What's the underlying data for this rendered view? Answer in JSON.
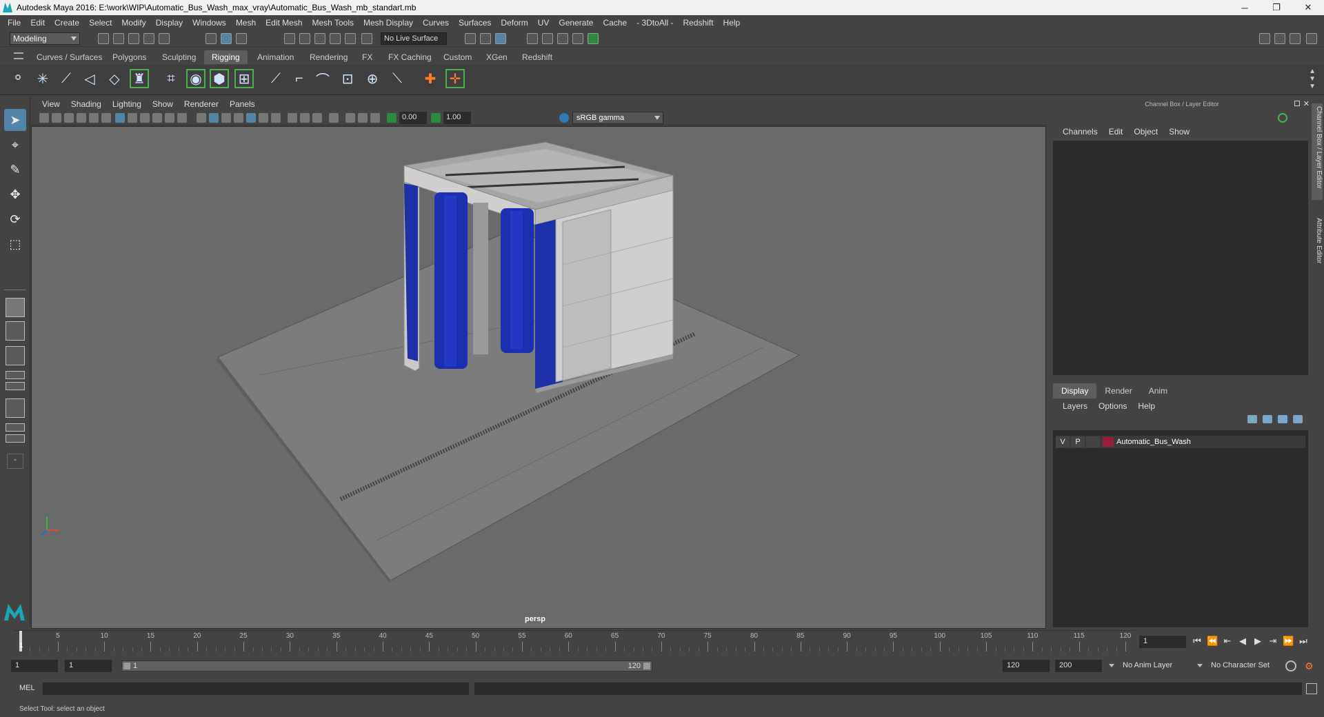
{
  "window": {
    "title": "Autodesk Maya 2016: E:\\work\\WIP\\Automatic_Bus_Wash_max_vray\\Automatic_Bus_Wash_mb_standart.mb",
    "minimize": "─",
    "restore": "❐",
    "close": "✕"
  },
  "menubar": [
    "File",
    "Edit",
    "Create",
    "Select",
    "Modify",
    "Display",
    "Windows",
    "Mesh",
    "Edit Mesh",
    "Mesh Tools",
    "Mesh Display",
    "Curves",
    "Surfaces",
    "Deform",
    "UV",
    "Generate",
    "Cache",
    "- 3DtoAll -",
    "Redshift",
    "Help"
  ],
  "statusline": {
    "mode": "Modeling",
    "live_surface": "No Live Surface"
  },
  "shelf_tabs": [
    "Curves / Surfaces",
    "Polygons",
    "Sculpting",
    "Rigging",
    "Animation",
    "Rendering",
    "FX",
    "FX Caching",
    "Custom",
    "XGen",
    "Redshift"
  ],
  "active_shelf_tab": "Rigging",
  "viewport": {
    "menu": [
      "View",
      "Shading",
      "Lighting",
      "Show",
      "Renderer",
      "Panels"
    ],
    "exposure": "0.00",
    "gamma": "1.00",
    "color_space": "sRGB gamma",
    "camera_label": "persp"
  },
  "channel_box": {
    "header": "Channel Box / Layer Editor",
    "menu": [
      "Channels",
      "Edit",
      "Object",
      "Show"
    ]
  },
  "layer_editor": {
    "tabs": [
      "Display",
      "Render",
      "Anim"
    ],
    "active_tab": "Display",
    "menu": [
      "Layers",
      "Options",
      "Help"
    ],
    "layers": [
      {
        "visible": "V",
        "playback": "P",
        "color": "#9a1e3a",
        "name": "Automatic_Bus_Wash"
      }
    ]
  },
  "side_tabs": [
    "Channel Box / Layer Editor",
    "Attribute Editor"
  ],
  "timeline": {
    "ticks": [
      "5",
      "10",
      "15",
      "20",
      "25",
      "30",
      "35",
      "40",
      "45",
      "50",
      "55",
      "60",
      "65",
      "70",
      "75",
      "80",
      "85",
      "90",
      "95",
      "100",
      "105",
      "110",
      "115",
      "120"
    ],
    "current_frame": "1",
    "playhead_label": "1"
  },
  "range": {
    "start": "1",
    "inner_start": "1",
    "bar_start": "1",
    "bar_end": "120",
    "end": "120",
    "anim_end": "200",
    "anim_layer": "No Anim Layer",
    "character_set": "No Character Set"
  },
  "command_line": {
    "label": "MEL"
  },
  "help_line": "Select Tool: select an object"
}
